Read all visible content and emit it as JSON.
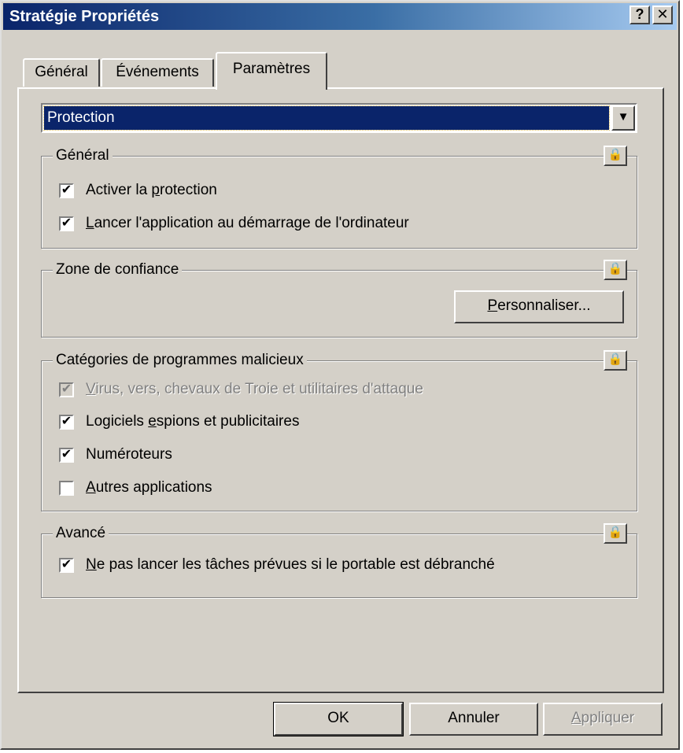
{
  "window": {
    "title": "Stratégie Propriétés",
    "help_label": "?",
    "close_label": "✕"
  },
  "tabs": [
    {
      "label": "Général",
      "active": false
    },
    {
      "label": "Événements",
      "active": false
    },
    {
      "label": "Paramètres",
      "active": true
    }
  ],
  "dropdown": {
    "value": "Protection",
    "arrow": "▼"
  },
  "lock_icon": "🔒",
  "groups": {
    "general": {
      "title": "Général",
      "items": [
        {
          "pre": "Activer la ",
          "u": "p",
          "post": "rotection",
          "checked": true,
          "disabled": false
        },
        {
          "pre": "",
          "u": "L",
          "post": "ancer l'application au démarrage de l'ordinateur",
          "checked": true,
          "disabled": false
        }
      ]
    },
    "trust": {
      "title": "Zone de confiance",
      "button": {
        "u": "P",
        "post": "ersonnaliser..."
      }
    },
    "malware": {
      "title": "Catégories de programmes malicieux",
      "items": [
        {
          "pre": "",
          "u": "V",
          "post": "irus, vers, chevaux de Troie et utilitaires d'attaque",
          "checked": true,
          "disabled": true
        },
        {
          "pre": "Logiciels ",
          "u": "e",
          "post": "spions et publicitaires",
          "checked": true,
          "disabled": false
        },
        {
          "pre": "Numéroteurs",
          "u": "",
          "post": "",
          "checked": true,
          "disabled": false
        },
        {
          "pre": "",
          "u": "A",
          "post": "utres applications",
          "checked": false,
          "disabled": false
        }
      ]
    },
    "advanced": {
      "title": "Avancé",
      "items": [
        {
          "pre": "",
          "u": "N",
          "post": "e pas lancer les tâches prévues si le portable est débranché",
          "checked": true,
          "disabled": false
        }
      ]
    }
  },
  "footer": {
    "ok": "OK",
    "cancel": "Annuler",
    "apply_u": "A",
    "apply_post": "ppliquer"
  },
  "checkmark": "✔"
}
